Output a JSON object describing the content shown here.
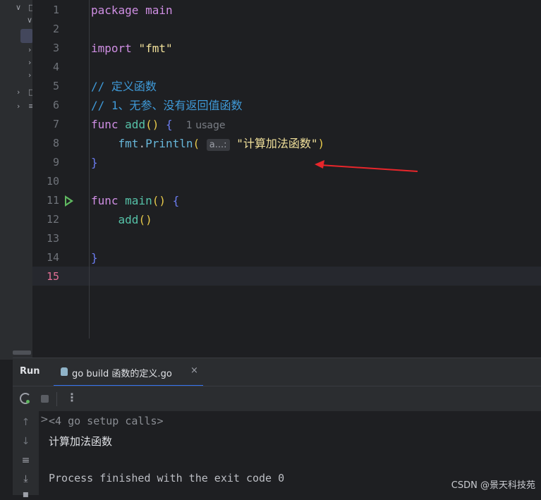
{
  "editor": {
    "line_numbers": [
      "1",
      "2",
      "3",
      "4",
      "5",
      "6",
      "7",
      "8",
      "9",
      "10",
      "11",
      "12",
      "13",
      "14",
      "15"
    ],
    "current_line": "15",
    "code": {
      "l1_kw": "package",
      "l1_name": "main",
      "l3_kw": "import",
      "l3_str": "\"fmt\"",
      "l5_comment": "// 定义函数",
      "l6_comment": "// 1、无参、没有返回值函数",
      "l7_kw": "func",
      "l7_name": "add",
      "l7_parens": "()",
      "l7_brace": "{",
      "l7_hint": "1 usage",
      "l8_pkg": "fmt",
      "l8_dot": ".",
      "l8_call": "Println",
      "l8_paren_open": "(",
      "l8_inlay": "a...:",
      "l8_str": "\"计算加法函数\"",
      "l8_paren_close": ")",
      "l9_brace": "}",
      "l11_kw": "func",
      "l11_name": "main",
      "l11_parens": "()",
      "l11_brace": "{",
      "l12_call": "add",
      "l12_parens": "()",
      "l14_brace": "}"
    }
  },
  "run_panel": {
    "title": "Run",
    "tab_label": "go build 函数的定义.go",
    "tab_close": "×",
    "more": "⋮",
    "console": {
      "setup_chevron": ">",
      "setup_line": "<4 go setup calls>",
      "output": "计算加法函数",
      "exit_line": "Process finished with the exit code 0"
    }
  },
  "watermark": "CSDN @景天科技苑",
  "colors": {
    "accent": "#3574f0",
    "annotation_arrow": "#e8262b",
    "run_green": "#5fb860"
  }
}
